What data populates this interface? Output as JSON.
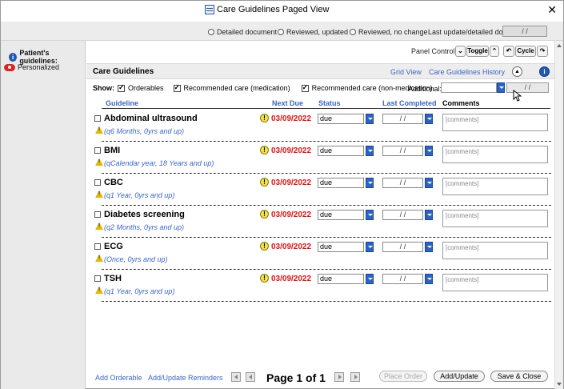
{
  "window": {
    "title": "Care Guidelines Paged View",
    "close_glyph": "✕"
  },
  "topbar": {
    "radio_detailed": "Detailed document",
    "radio_reviewed_updated": "Reviewed, updated",
    "radio_reviewed_nochange": "Reviewed, no change",
    "last_update_label": "Last update/detailed doc:",
    "last_update_value": "/ /"
  },
  "sidebar": {
    "heading": "Patient's guidelines:",
    "item": "Personalized"
  },
  "panel_control": {
    "label": "Panel Control:",
    "toggle": "Toggle",
    "cycle": "Cycle"
  },
  "care_guidelines": {
    "title": "Care Guidelines",
    "grid_view": "Grid View",
    "history": "Care Guidelines History"
  },
  "show": {
    "label": "Show:",
    "orderables": "Orderables",
    "rec_med": "Recommended care (medication)",
    "rec_nonmed": "Recommended care (non-medication)",
    "additional_label": "Additional:",
    "additional_value": "",
    "additional_date": "/ /"
  },
  "columns": {
    "guideline": "Guideline",
    "next_due": "Next Due",
    "status": "Status",
    "last_completed": "Last Completed",
    "comments": "Comments"
  },
  "rows": [
    {
      "name": "Abdominal ultrasound",
      "freq": "(q6 Months, 0yrs and up)",
      "due": "03/09/2022",
      "status": "due",
      "last": "/ /",
      "comment": "[comments]"
    },
    {
      "name": "BMI",
      "freq": "(qCalendar year, 18 Years and up)",
      "due": "03/09/2022",
      "status": "due",
      "last": "/ /",
      "comment": "[comments]"
    },
    {
      "name": "CBC",
      "freq": "(q1 Year, 0yrs and up)",
      "due": "03/09/2022",
      "status": "due",
      "last": "/ /",
      "comment": "[comments]"
    },
    {
      "name": "Diabetes screening",
      "freq": "(q2 Months, 0yrs and up)",
      "due": "03/09/2022",
      "status": "due",
      "last": "/ /",
      "comment": "[comments]"
    },
    {
      "name": "ECG",
      "freq": "(Once, 0yrs and up)",
      "due": "03/09/2022",
      "status": "due",
      "last": "/ /",
      "comment": "[comments]"
    },
    {
      "name": "TSH",
      "freq": "(q1 Year, 0yrs and up)",
      "due": "03/09/2022",
      "status": "due",
      "last": "/ /",
      "comment": "[comments]"
    }
  ],
  "footer": {
    "add_orderable": "Add Orderable",
    "add_update_reminders": "Add/Update Reminders",
    "page_info": "Page 1 of 1",
    "place_order": "Place Order",
    "add_update": "Add/Update",
    "save_close": "Save & Close"
  }
}
